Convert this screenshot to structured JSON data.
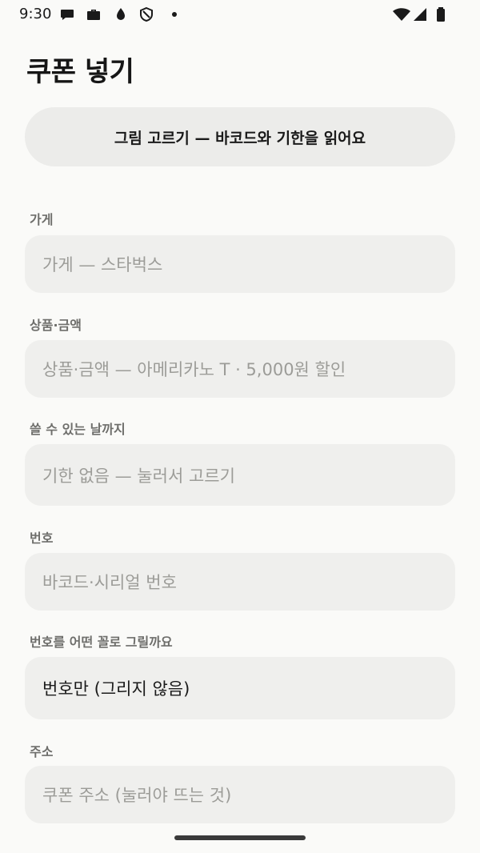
{
  "status_bar": {
    "time": "9:30",
    "icons_left": [
      "chat-icon",
      "briefcase-icon",
      "drop-icon",
      "shield-icon",
      "dot-icon"
    ],
    "icons_right": [
      "wifi-icon",
      "signal-icon",
      "battery-icon"
    ]
  },
  "page": {
    "title": "쿠폰 넣기"
  },
  "pick_image_button": {
    "label": "그림 고르기 — 바코드와 기한을 읽어요"
  },
  "fields": {
    "store": {
      "label": "가게",
      "placeholder": "가게 — 스타벅스"
    },
    "product": {
      "label": "상품·금액",
      "placeholder": "상품·금액 — 아메리카노 T · 5,000원 할인"
    },
    "expiry": {
      "label": "쓸 수 있는 날까지",
      "placeholder": "기한 없음 — 눌러서 고르기"
    },
    "number": {
      "label": "번호",
      "placeholder": "바코드·시리얼 번호"
    },
    "draw_mode": {
      "label": "번호를 어떤 꼴로 그릴까요",
      "value": "번호만 (그리지 않음)"
    },
    "address": {
      "label": "주소",
      "placeholder": "쿠폰 주소 (눌러야 뜨는 것)"
    }
  },
  "colors": {
    "background": "#fafaf8",
    "field_background": "#efefed",
    "button_background": "#ececea",
    "label_text": "#6e6e6b",
    "placeholder_text": "#9c9c98"
  }
}
